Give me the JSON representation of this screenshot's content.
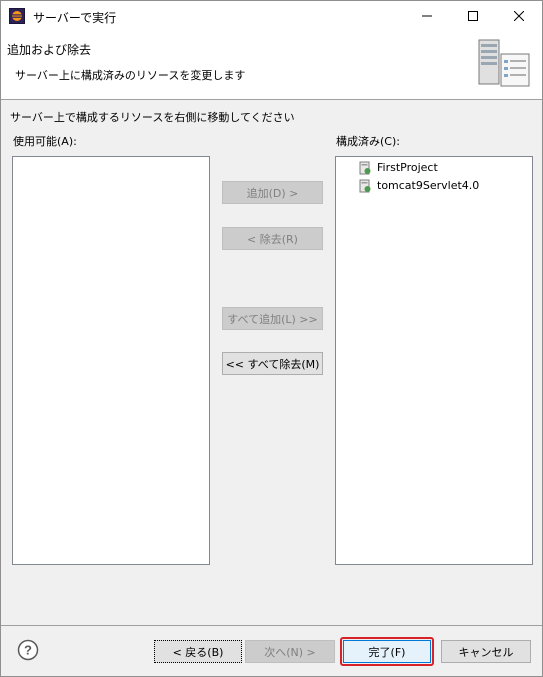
{
  "window": {
    "title": "サーバーで実行"
  },
  "banner": {
    "title": "追加および除去",
    "description": "サーバー上に構成済みのリソースを変更します"
  },
  "instruction": "サーバー上で構成するリソースを右側に移動してください",
  "available": {
    "label": "使用可能(A):",
    "items": []
  },
  "configured": {
    "label": "構成済み(C):",
    "items": [
      {
        "label": "FirstProject",
        "icon": "project-icon"
      },
      {
        "label": "tomcat9Servlet4.0",
        "icon": "project-icon"
      }
    ]
  },
  "buttons": {
    "add": "追加(D) >",
    "remove": "< 除去(R)",
    "add_all": "すべて追加(L) >>",
    "remove_all": "<< すべて除去(M)",
    "back": "< 戻る(B)",
    "next": "次へ(N) >",
    "finish": "完了(F)",
    "cancel": "キャンセル"
  },
  "colors": {
    "finish_highlight": "#d8222a",
    "disabled_text": "#808080",
    "focus_blue": "#0078d7"
  }
}
